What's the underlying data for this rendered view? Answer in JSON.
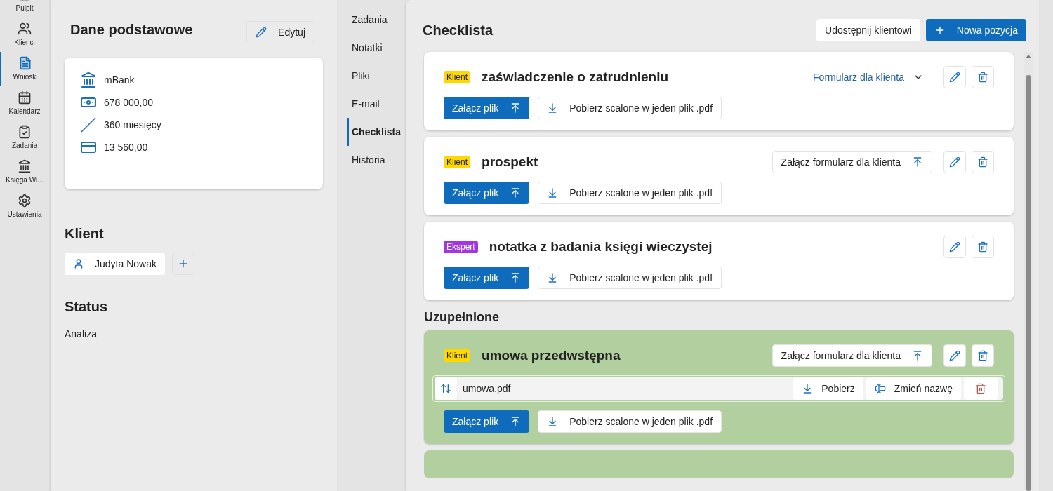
{
  "nav": [
    {
      "label": "Pulpit",
      "selected": false
    },
    {
      "label": "Klienci",
      "selected": false
    },
    {
      "label": "Wnioski",
      "selected": true
    },
    {
      "label": "Kalendarz",
      "selected": false
    },
    {
      "label": "Zadania",
      "selected": false
    },
    {
      "label": "Księga Wi...",
      "selected": false
    },
    {
      "label": "Ustawienia",
      "selected": false
    }
  ],
  "basic": {
    "title": "Dane podstawowe",
    "edit_button": "Edytuj",
    "rows": [
      {
        "kind": "bank",
        "text": "mBank"
      },
      {
        "kind": "money",
        "text": "678 000,00"
      },
      {
        "kind": "term",
        "text": "360 miesięcy"
      },
      {
        "kind": "installment",
        "text": "13 560,00"
      }
    ]
  },
  "client": {
    "title": "Klient",
    "name": "Judyta Nowak"
  },
  "status": {
    "title": "Status",
    "value": "Analiza"
  },
  "tabs": [
    {
      "label": "Zadania",
      "selected": false
    },
    {
      "label": "Notatki",
      "selected": false
    },
    {
      "label": "Pliki",
      "selected": false
    },
    {
      "label": "E-mail",
      "selected": false
    },
    {
      "label": "Checklista",
      "selected": true
    },
    {
      "label": "Historia",
      "selected": false
    }
  ],
  "checklist": {
    "title": "Checklista",
    "share_button": "Udostępnij klientowi",
    "new_button": "Nowa pozycja",
    "items": [
      {
        "badge": "Klient",
        "color": "#ffd800",
        "title": "zaświadczenie o zatrudnieniu",
        "form": {
          "kind": "dropdown",
          "label": "Formularz dla klienta"
        },
        "attach_button": "Załącz plik",
        "download_button": "Pobierz scalone w jeden plik .pdf",
        "completed": false
      },
      {
        "badge": "Klient",
        "color": "#ffd800",
        "title": "prospekt",
        "form": {
          "kind": "upload",
          "label": "Załącz formularz dla klienta"
        },
        "attach_button": "Załącz plik",
        "download_button": "Pobierz scalone w jeden plik .pdf",
        "completed": false
      },
      {
        "badge": "Ekspert",
        "color": "#a336e0",
        "title": "notatka z badania księgi wieczystej",
        "form": {
          "kind": "none"
        },
        "attach_button": "Załącz plik",
        "download_button": "Pobierz scalone w jeden plik .pdf",
        "completed": false
      }
    ],
    "completed_title": "Uzupełnione",
    "completed_items": [
      {
        "badge": "Klient",
        "color": "#ffd800",
        "title": "umowa przedwstępna",
        "form": {
          "kind": "upload",
          "label": "Załącz formularz dla klienta"
        },
        "files": [
          {
            "name": "umowa.pdf",
            "download": "Pobierz",
            "rename": "Zmień nazwę"
          }
        ],
        "attach_button": "Załącz plik",
        "download_button": "Pobierz scalone w jeden plik .pdf",
        "completed": true
      }
    ]
  }
}
